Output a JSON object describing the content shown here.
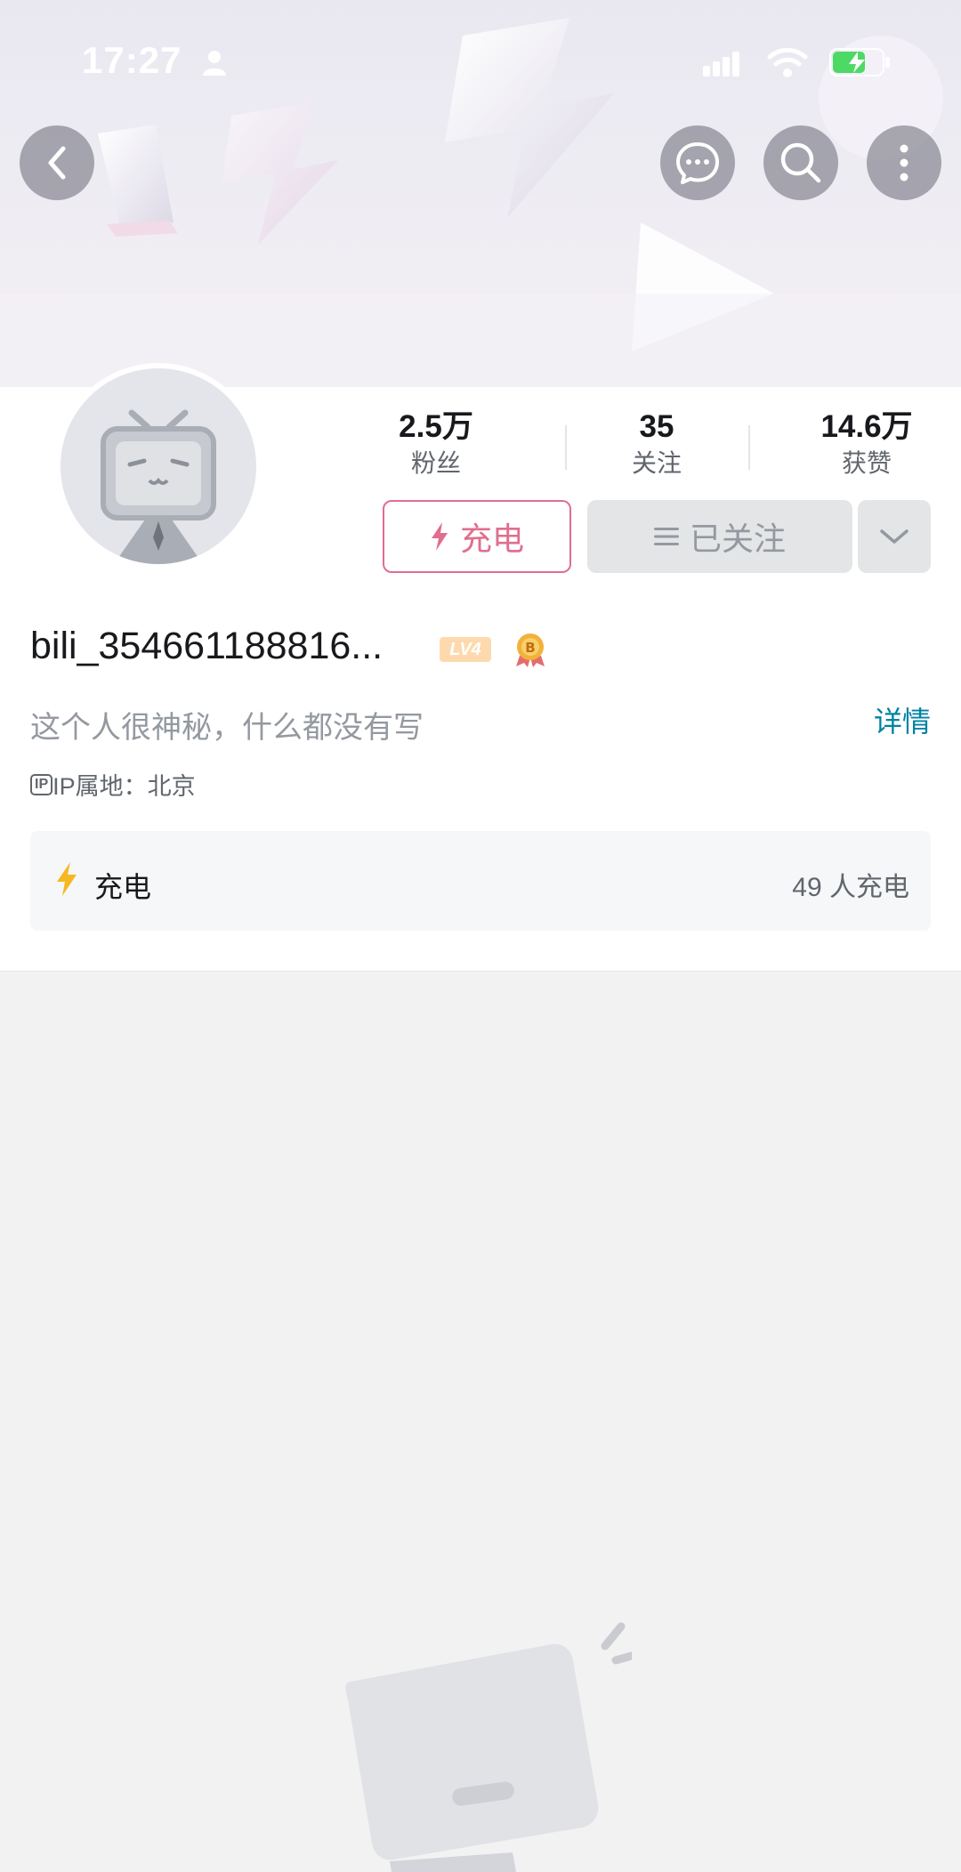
{
  "status_bar": {
    "time": "17:27",
    "icons": [
      "person-icon",
      "signal-icon",
      "wifi-icon",
      "battery-charging-icon"
    ]
  },
  "nav": {
    "back_icon": "chevron-left-icon",
    "message_icon": "chat-bubble-icon",
    "search_icon": "search-icon",
    "more_icon": "more-vertical-icon"
  },
  "stats": [
    {
      "value": "2.5万",
      "label": "粉丝"
    },
    {
      "value": "35",
      "label": "关注"
    },
    {
      "value": "14.6万",
      "label": "获赞"
    }
  ],
  "actions": {
    "charge_label": "充电",
    "follow_label": "已关注",
    "dropdown_icon": "chevron-down-icon"
  },
  "profile": {
    "username": "bili_354661188816...",
    "level_badge": "LV4",
    "signature": "这个人很神秘，什么都没有写",
    "detail_link": "详情",
    "ip_badge": "IP",
    "ip_location": "IP属地：北京"
  },
  "charge_panel": {
    "label": "充电",
    "count": "49 人充电"
  },
  "colors": {
    "accent_pink": "#e06e8f",
    "link_blue": "#0083a5",
    "bolt_yellow": "#f5b822"
  }
}
